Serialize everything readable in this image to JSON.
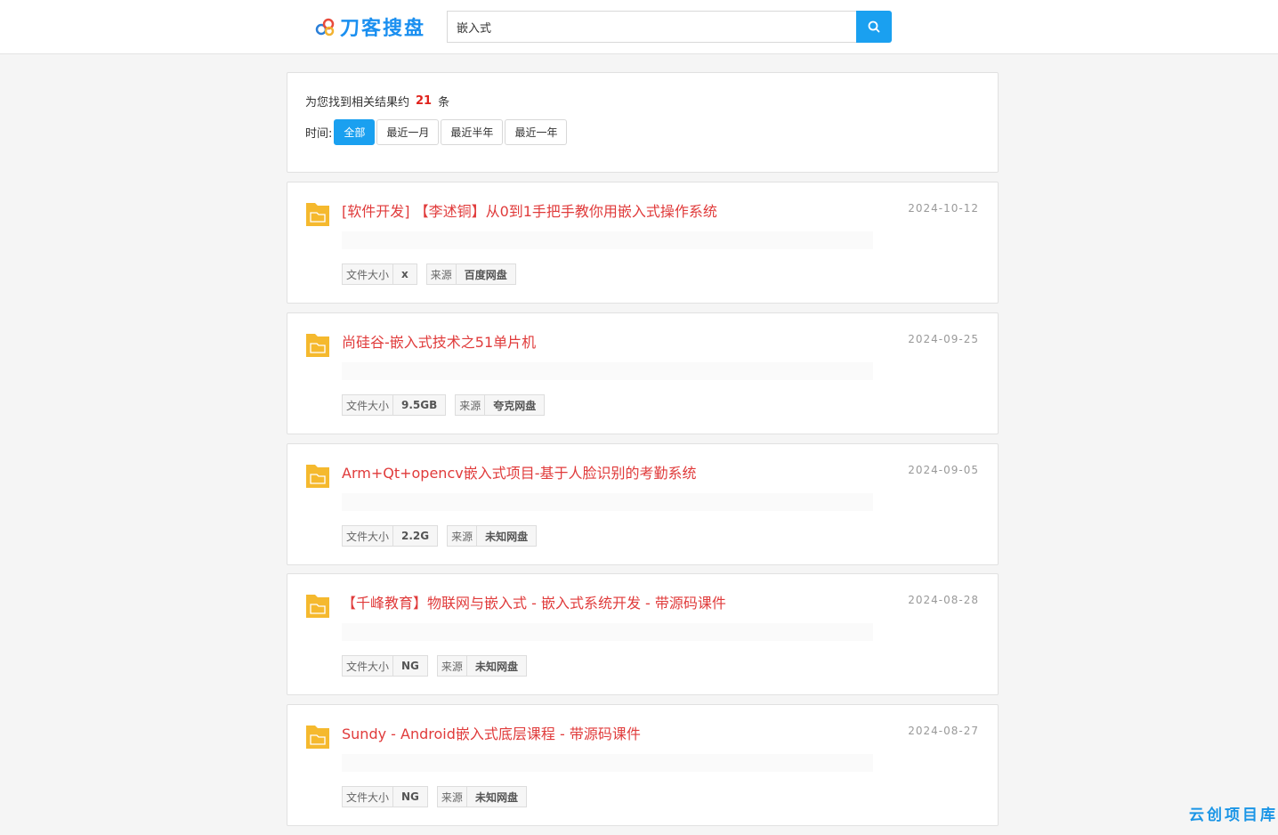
{
  "header": {
    "logo_text": "刀客搜盘",
    "search_value": "嵌入式",
    "search_icon": "search-icon"
  },
  "summary": {
    "prefix": "为您找到相关结果约",
    "count": "21",
    "suffix": "条",
    "time_label": "时间:",
    "time_filters": [
      "全部",
      "最近一月",
      "最近半年",
      "最近一年"
    ],
    "active_filter": "全部"
  },
  "results": [
    {
      "title": "[软件开发] 【李述铜】从0到1手把手教你用嵌入式操作系统",
      "date": "2024-10-12",
      "size_label": "文件大小",
      "size": "x",
      "source_label": "来源",
      "source": "百度网盘"
    },
    {
      "title": "尚硅谷-嵌入式技术之51单片机",
      "date": "2024-09-25",
      "size_label": "文件大小",
      "size": "9.5GB",
      "source_label": "来源",
      "source": "夸克网盘"
    },
    {
      "title": "Arm+Qt+opencv嵌入式项目-基于人脸识别的考勤系统",
      "date": "2024-09-05",
      "size_label": "文件大小",
      "size": "2.2G",
      "source_label": "来源",
      "source": "未知网盘"
    },
    {
      "title": "【千峰教育】物联网与嵌入式 - 嵌入式系统开发 - 带源码课件",
      "date": "2024-08-28",
      "size_label": "文件大小",
      "size": "NG",
      "source_label": "来源",
      "source": "未知网盘"
    },
    {
      "title": "Sundy - Android嵌入式底层课程 - 带源码课件",
      "date": "2024-08-27",
      "size_label": "文件大小",
      "size": "NG",
      "source_label": "来源",
      "source": "未知网盘"
    }
  ],
  "watermark": "云创项目库",
  "colors": {
    "accent": "#1aa0f0",
    "title": "#e03b3b",
    "count": "#e0221c",
    "folder": "#f5b92e"
  }
}
